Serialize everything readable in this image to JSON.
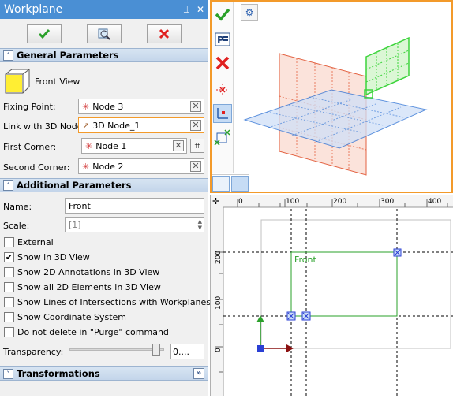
{
  "panel": {
    "title": "Workplane",
    "pin_glyph": "⫫",
    "close_glyph": "✕",
    "toolbar": {
      "ok_icon": "check-icon",
      "preview_icon": "preview-icon",
      "cancel_icon": "cancel-icon"
    }
  },
  "general": {
    "header": "General Parameters",
    "type_label": "Front View",
    "fixing_point_label": "Fixing Point:",
    "fixing_point_value": "Node 3",
    "link_label": "Link with 3D Node:",
    "link_value": "3D Node_1",
    "first_corner_label": "First Corner:",
    "first_corner_value": "Node 1",
    "second_corner_label": "Second Corner:",
    "second_corner_value": "Node 2"
  },
  "additional": {
    "header": "Additional Parameters",
    "name_label": "Name:",
    "name_value": "Front",
    "scale_label": "Scale:",
    "scale_value": "[1]",
    "checks": [
      {
        "label": "External",
        "checked": false
      },
      {
        "label": "Show in 3D View",
        "checked": true
      },
      {
        "label": "Show 2D Annotations in 3D View",
        "checked": false
      },
      {
        "label": "Show all 2D Elements in 3D View",
        "checked": false
      },
      {
        "label": "Show Lines of Intersections with Workplanes",
        "checked": false
      },
      {
        "label": "Show Coordinate System",
        "checked": false
      },
      {
        "label": "Do not delete in \"Purge\" command",
        "checked": false
      }
    ],
    "transparency_label": "Transparency:",
    "transparency_value": "0....",
    "transparency_level": 0.95
  },
  "transformations": {
    "header": "Transformations",
    "expand_glyph": "»"
  },
  "view2d": {
    "ruler_top": [
      "0",
      "100",
      "200",
      "300",
      "400"
    ],
    "ruler_left": [
      "200",
      "100",
      "0"
    ],
    "label": "Front"
  },
  "colors": {
    "accent": "#f39a2a",
    "title": "#4a8fd4",
    "green": "#2aa02a",
    "red": "#e02020"
  }
}
